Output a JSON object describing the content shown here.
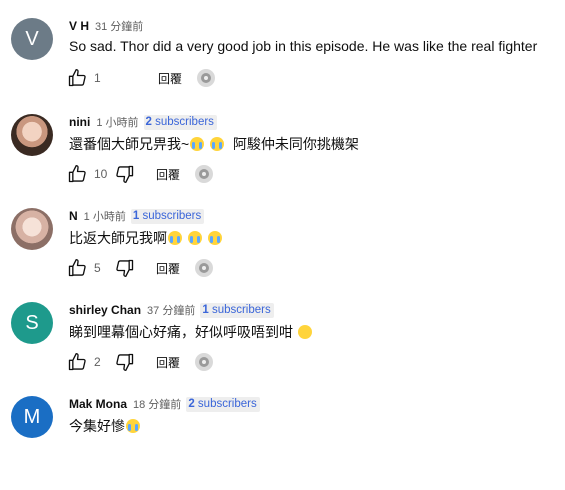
{
  "comments": [
    {
      "avatar_letter": "V",
      "avatar_color": "#6c7b87",
      "author": "V H",
      "time": "31 分鐘前",
      "subscribers_count": "",
      "subscribers_label": "",
      "text": "So sad. Thor did a very good job in this episode. He was like the real fighter",
      "likes": "1",
      "reply_label": "回覆"
    },
    {
      "avatar_letter": "",
      "avatar_color": "",
      "author": "nini",
      "time": "1 小時前",
      "subscribers_count": "2",
      "subscribers_label": "subscribers",
      "text": "還番個大師兄畀我~",
      "text_after": "阿駿仲未同你挑機架",
      "likes": "10",
      "reply_label": "回覆"
    },
    {
      "avatar_letter": "",
      "avatar_color": "",
      "author": "N",
      "time": "1 小時前",
      "subscribers_count": "1",
      "subscribers_label": "subscribers",
      "text": "比返大師兄我啊",
      "likes": "5",
      "reply_label": "回覆"
    },
    {
      "avatar_letter": "S",
      "avatar_color": "#1e9a8c",
      "author": "shirley Chan",
      "time": "37 分鐘前",
      "subscribers_count": "1",
      "subscribers_label": "subscribers",
      "text": "睇到哩幕個心好痛，好似呼吸唔到咁",
      "likes": "2",
      "reply_label": "回覆"
    },
    {
      "avatar_letter": "M",
      "avatar_color": "#1a6ec4",
      "author": "Mak Mona",
      "time": "18 分鐘前",
      "subscribers_count": "2",
      "subscribers_label": "subscribers",
      "text": "今集好慘",
      "likes": "",
      "reply_label": ""
    }
  ],
  "icons": [
    "thumbs-up-icon",
    "thumbs-down-icon",
    "creator-avatar-icon",
    "crying-emoji-icon",
    "sad-emoji-icon"
  ]
}
